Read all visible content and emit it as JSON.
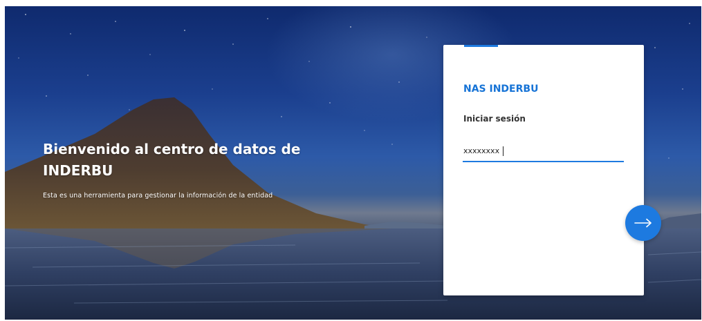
{
  "hero": {
    "title": "Bienvenido al centro de datos de INDERBU",
    "subtitle": "Esta es una herramienta para gestionar la información de la entidad"
  },
  "login": {
    "brand": "NAS INDERBU",
    "label": "Iniciar sesión",
    "password_value": "xxxxxxxx",
    "submit_icon": "arrow-right-icon"
  },
  "colors": {
    "accent": "#1d7ae0",
    "brand_text": "#1673d6"
  }
}
